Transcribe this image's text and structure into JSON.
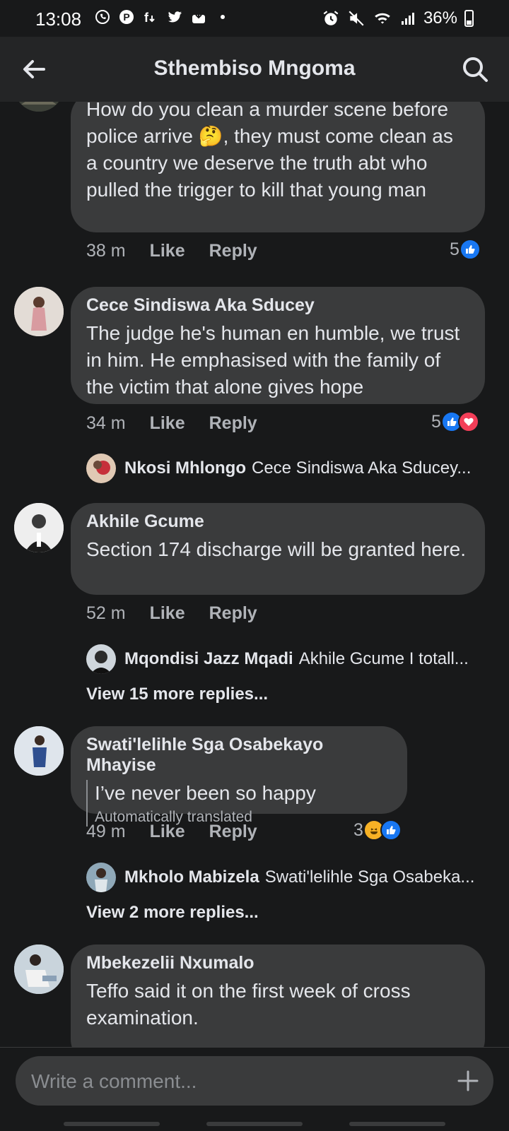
{
  "status": {
    "time": "13:08",
    "battery": "36%",
    "left_icons": [
      "whatsapp-icon",
      "pinterest-icon",
      "facebook-lite-icon",
      "twitter-icon",
      "download-icon",
      "dot-icon"
    ],
    "right_icons": [
      "alarm-icon",
      "mute-icon",
      "wifi-icon",
      "signal-icon",
      "battery-icon"
    ]
  },
  "header": {
    "title": "Sthembiso Mngoma"
  },
  "comments": [
    {
      "name": "",
      "text": "How do you clean a murder scene before police arrive 🤔, they must come clean as a country we deserve the truth abt who pulled the trigger to kill that young man",
      "time": "38 m",
      "like": "Like",
      "reply": "Reply",
      "reactions": {
        "count": "5",
        "types": [
          "like"
        ]
      }
    },
    {
      "name": "Cece Sindiswa Aka Sducey",
      "text": "The judge he's human en humble, we trust in him. He emphasised with the family of the victim that alone gives hope",
      "time": "34 m",
      "like": "Like",
      "reply": "Reply",
      "reactions": {
        "count": "5",
        "types": [
          "like",
          "love"
        ]
      },
      "reply_preview": {
        "name": "Nkosi Mhlongo",
        "text": "Cece Sindiswa Aka Sducey..."
      }
    },
    {
      "name": "Akhile Gcume",
      "text": "Section 174 discharge will be granted here.",
      "time": "52 m",
      "like": "Like",
      "reply": "Reply",
      "reply_preview": {
        "name": "Mqondisi Jazz Mqadi",
        "text": "Akhile Gcume I totall..."
      },
      "view_more": "View 15 more replies..."
    },
    {
      "name": "Swati'lelihle Sga Osabekayo Mhayise",
      "text": "I’ve never been so happy",
      "note": "Automatically translated",
      "time": "49 m",
      "like": "Like",
      "reply": "Reply",
      "reactions": {
        "count": "3",
        "types": [
          "haha",
          "like"
        ]
      },
      "reply_preview": {
        "name": "Mkholo Mabizela",
        "text": "Swati'lelihle Sga Osabeka..."
      },
      "view_more": "View 2 more replies..."
    },
    {
      "name": "Mbekezelii Nxumalo",
      "text": "Teffo said it on the first week of cross examination."
    }
  ],
  "composer": {
    "placeholder": "Write a comment..."
  },
  "colors": {
    "background": "#18191a",
    "bubble": "#3a3b3c",
    "like": "#1877f2",
    "love": "#f33e58"
  }
}
